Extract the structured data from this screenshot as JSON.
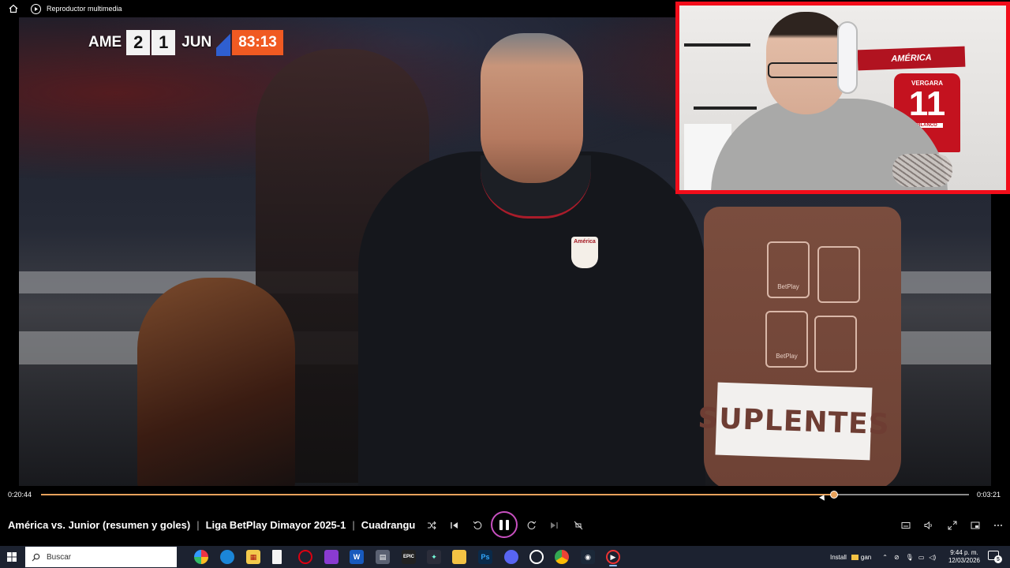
{
  "window": {
    "title": "Reproductor multimedia"
  },
  "scoreboard": {
    "home_team": "AME",
    "home_score": "2",
    "away_score": "1",
    "away_team": "JUN",
    "clock": "83:13"
  },
  "video_scene": {
    "crest_text": "América",
    "bib_text": "SUPLENTES",
    "bib_logo_text": "BetPlay"
  },
  "webcam": {
    "banner_text": "AMÉRICA",
    "jersey_name": "VERGARA",
    "jersey_number": "11",
    "jersey_tag": "BLANCO"
  },
  "progress": {
    "elapsed": "0:20:44",
    "remaining": "0:03:21",
    "fraction": 0.855
  },
  "media": {
    "title_part1": "América vs. Junior (resumen y goles)",
    "title_part2": "Liga BetPlay Dimayor 2025-1",
    "title_part3": "Cuadrangu..."
  },
  "taskbar": {
    "search_placeholder": "Buscar",
    "tray_install": "Install",
    "tray_folder": "gan",
    "clock_time": "9:44 p. m.",
    "clock_date": "12/03/2026",
    "notification_count": "5"
  },
  "colors": {
    "accent_progress": "#e7a15b",
    "play_ring": "#c850c0",
    "webcam_border": "#f20d1a",
    "scoreboard_clock": "#f05a22"
  }
}
